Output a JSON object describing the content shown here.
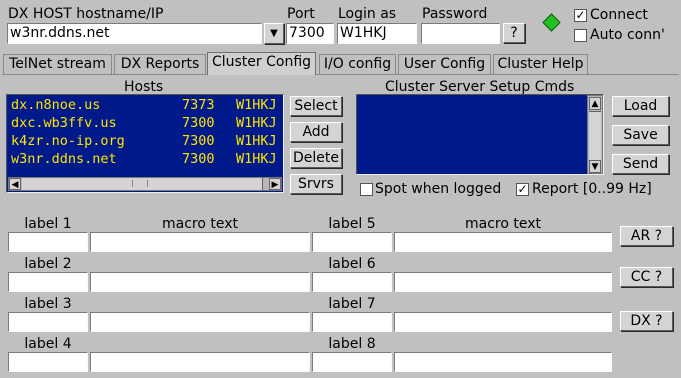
{
  "header": {
    "host_label": "DX HOST hostname/IP",
    "host_value": "w3nr.ddns.net",
    "port_label": "Port",
    "port_value": "7300",
    "login_label": "Login as",
    "login_value": "W1HKJ",
    "password_label": "Password",
    "password_value": "",
    "help_button": "?",
    "connect_label": "Connect",
    "connect_checked": "✓",
    "auto_label": "Auto conn'",
    "auto_checked": "",
    "status_color": "#22c022"
  },
  "tabs": [
    {
      "label": "TelNet stream"
    },
    {
      "label": "DX Reports"
    },
    {
      "label": "Cluster Config"
    },
    {
      "label": "I/O config"
    },
    {
      "label": "User Config"
    },
    {
      "label": "Cluster Help"
    }
  ],
  "hosts": {
    "title": "Hosts",
    "rows": [
      {
        "host": "dx.n8noe.us",
        "port": "7373",
        "login": "W1HKJ"
      },
      {
        "host": "dxc.wb3ffv.us",
        "port": "7300",
        "login": "W1HKJ"
      },
      {
        "host": "k4zr.no-ip.org",
        "port": "7300",
        "login": "W1HKJ"
      },
      {
        "host": "w3nr.ddns.net",
        "port": "7300",
        "login": "W1HKJ"
      }
    ],
    "buttons": {
      "select": "Select",
      "add": "Add",
      "delete": "Delete",
      "servers": "Srvrs"
    }
  },
  "setup": {
    "title": "Cluster Server Setup Cmds",
    "buttons": {
      "load": "Load",
      "save": "Save",
      "send": "Send"
    },
    "spot_label": "Spot when logged",
    "spot_checked": "",
    "report_label": "Report [0..99 Hz]",
    "report_checked": "✓"
  },
  "macros": {
    "left_header_label": "label 1",
    "left_header_text": "macro text",
    "right_header_text": "macro text",
    "labels": [
      "label 1",
      "label 2",
      "label 3",
      "label 4",
      "label 5",
      "label 6",
      "label 7",
      "label 8"
    ],
    "buttons": {
      "ar": "AR ?",
      "cc": "CC ?",
      "dx": "DX ?"
    }
  },
  "colors": {
    "list_bg": "#001a8c",
    "list_text": "#ffe400"
  }
}
